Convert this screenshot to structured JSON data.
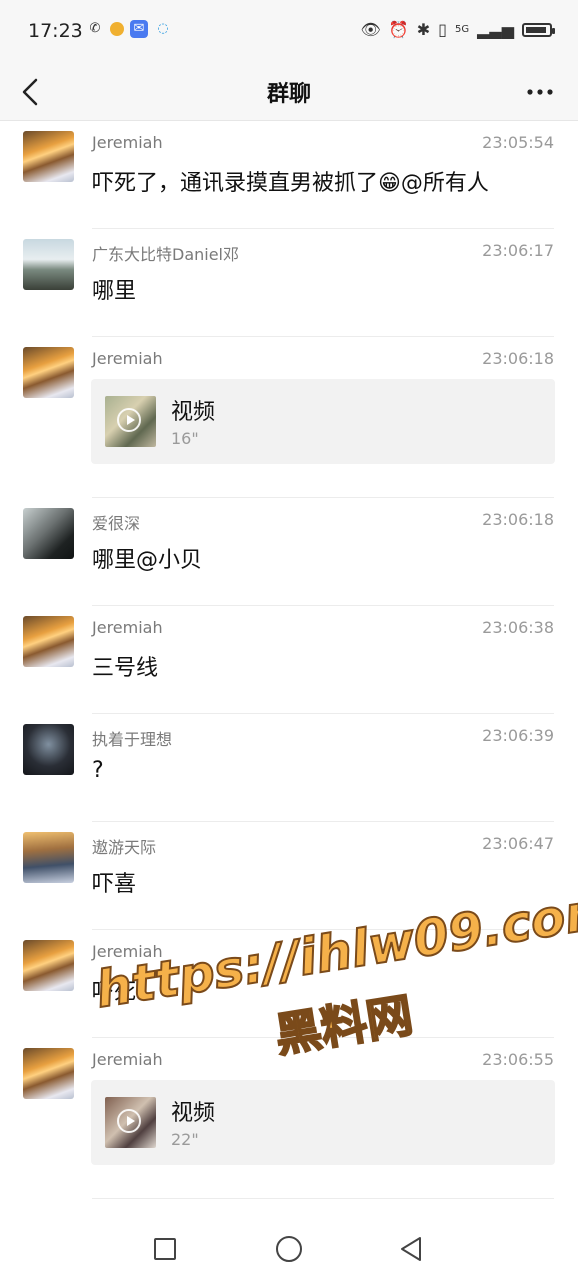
{
  "status_bar": {
    "time": "17:23",
    "network": "5G"
  },
  "header": {
    "title": "群聊"
  },
  "messages": [
    {
      "name": "Jeremiah",
      "time": "23:05:54",
      "text": "吓死了，通讯录摸直男被抓了😁@所有人",
      "avatar": "sunset"
    },
    {
      "name": "广东大比特Daniel邓",
      "time": "23:06:17",
      "text": "哪里",
      "avatar": "man"
    },
    {
      "name": "Jeremiah",
      "time": "23:06:18",
      "video_label": "视频",
      "video_duration": "16\"",
      "avatar": "sunset"
    },
    {
      "name": "爱很深",
      "time": "23:06:18",
      "text": "哪里@小贝",
      "avatar": "dark"
    },
    {
      "name": "Jeremiah",
      "time": "23:06:38",
      "text": "三号线",
      "avatar": "sunset"
    },
    {
      "name": "执着于理想",
      "time": "23:06:39",
      "text": "?",
      "avatar": "anime"
    },
    {
      "name": "遨游天际",
      "time": "23:06:47",
      "text": "吓喜",
      "avatar": "mountain"
    },
    {
      "name": "Jeremiah",
      "time": "",
      "text": "吓死",
      "avatar": "sunset"
    },
    {
      "name": "Jeremiah",
      "time": "23:06:55",
      "video_label": "视频",
      "video_duration": "22\"",
      "avatar": "sunset"
    }
  ],
  "watermark": {
    "url": "https://ihlw09.com",
    "text": "黑料网"
  }
}
